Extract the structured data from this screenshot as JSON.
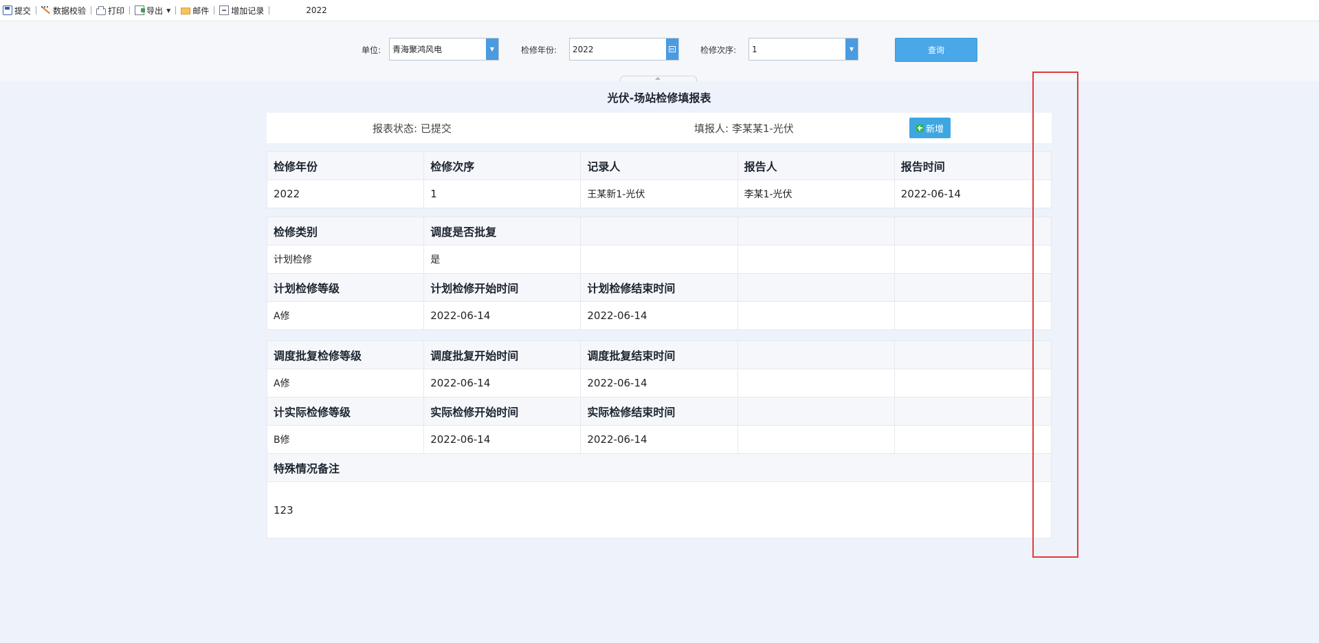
{
  "toolbar": {
    "submit": "提交",
    "validate": "数据校验",
    "print": "打印",
    "export": "导出",
    "mail": "邮件",
    "add_record": "增加记录",
    "year": "2022"
  },
  "filter": {
    "unit_label": "单位:",
    "unit_value": "青海聚鸿风电",
    "year_label": "检修年份:",
    "year_value": "2022",
    "order_label": "检修次序:",
    "order_value": "1",
    "query": "查询"
  },
  "report": {
    "title": "光伏-场站检修填报表",
    "status": "报表状态: 已提交",
    "reporter": "填报人: 李某某1-光伏",
    "add": "新增",
    "s1": {
      "headers": [
        "检修年份",
        "检修次序",
        "记录人",
        "报告人",
        "报告时间"
      ],
      "values": [
        "2022",
        "1",
        "王某新1-光伏",
        "李某1-光伏",
        "2022-06-14"
      ]
    },
    "s2": {
      "headers": [
        "检修类别",
        "调度是否批复"
      ],
      "values": [
        "计划检修",
        "是"
      ],
      "headers2": [
        "计划检修等级",
        "计划检修开始时间",
        "计划检修结束时间"
      ],
      "values2": [
        "A修",
        "2022-06-14",
        "2022-06-14"
      ]
    },
    "s3": {
      "headers": [
        "调度批复检修等级",
        "调度批复开始时间",
        "调度批复结束时间"
      ],
      "values": [
        "A修",
        "2022-06-14",
        "2022-06-14"
      ],
      "headers2": [
        "计实际检修等级",
        "实际检修开始时间",
        "实际检修结束时间"
      ],
      "values2": [
        "B修",
        "2022-06-14",
        "2022-06-14"
      ],
      "note_header": "特殊情况备注",
      "note_value": "123"
    }
  }
}
